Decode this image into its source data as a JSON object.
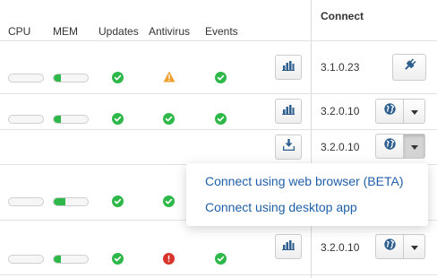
{
  "headers": {
    "cpu": "CPU",
    "mem": "MEM",
    "updates": "Updates",
    "antivirus": "Antivirus",
    "events": "Events",
    "connect": "Connect"
  },
  "colors": {
    "ok": "#2fb84a",
    "warning": "#f0a030",
    "error": "#d9342b",
    "icon_blue": "#2e5f8e",
    "link": "#1f5fa8"
  },
  "rows": [
    {
      "cpu": 0.0,
      "mem": 0.2,
      "updates": "ok",
      "antivirus": "warning",
      "events": "ok",
      "action_icon": "bar-chart-icon",
      "version": "3.1.0.23",
      "connect_icon": "plug-icon"
    },
    {
      "cpu": 0.0,
      "mem": 0.2,
      "updates": "ok",
      "antivirus": "ok",
      "events": "ok",
      "action_icon": "bar-chart-icon",
      "version": "3.2.0.10",
      "connect_icon": "globe-icon"
    },
    {
      "action_icon": "download-icon",
      "version": "3.2.0.10",
      "connect_icon": "globe-icon",
      "dropdown_open": true
    },
    {
      "cpu": 0.0,
      "mem": 0.35,
      "updates": "ok",
      "antivirus": "ok"
    },
    {
      "cpu": 0.0,
      "mem": 0.2,
      "updates": "ok",
      "antivirus": "error",
      "events": "ok",
      "action_icon": "bar-chart-icon",
      "version": "3.2.0.10",
      "connect_icon": "globe-icon"
    }
  ],
  "dropdown": {
    "items": [
      "Connect using web browser (BETA)",
      "Connect using desktop app"
    ]
  }
}
